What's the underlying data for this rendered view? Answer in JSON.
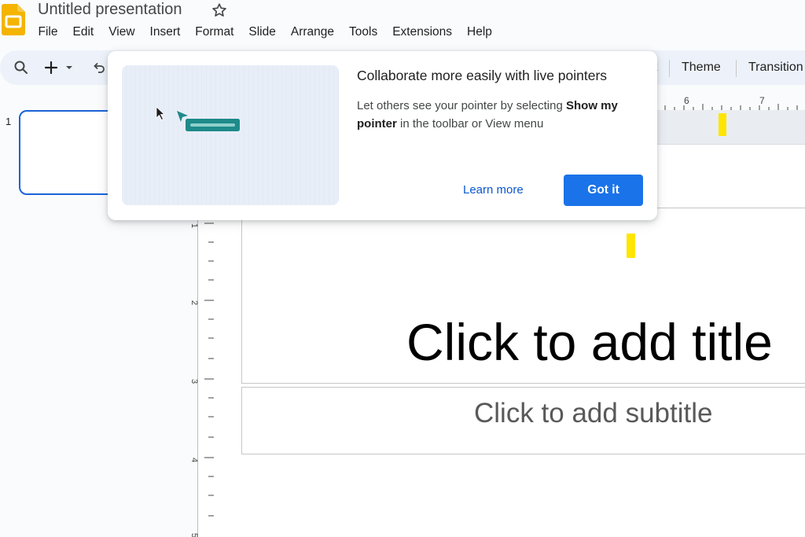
{
  "header": {
    "title": "Untitled presentation",
    "menu": [
      "File",
      "Edit",
      "View",
      "Insert",
      "Format",
      "Slide",
      "Arrange",
      "Tools",
      "Extensions",
      "Help"
    ]
  },
  "toolbar": {
    "theme_label": "Theme",
    "transition_label": "Transition",
    "partial_label": "t"
  },
  "ruler": {
    "h_labels": [
      "6",
      "7"
    ],
    "v_labels": [
      "1",
      "2",
      "3",
      "4",
      "5"
    ]
  },
  "filmstrip": {
    "slide_number": "1"
  },
  "slide": {
    "title_placeholder": "Click to add title",
    "subtitle_placeholder": "Click to add subtitle"
  },
  "popup": {
    "title": "Collaborate more easily with live pointers",
    "body_prefix": "Let others see your pointer by selecting ",
    "body_bold": "Show my pointer",
    "body_suffix": " in the toolbar or View menu",
    "learn_more": "Learn more",
    "got_it": "Got it"
  },
  "colors": {
    "accent": "#1a73e8",
    "link": "#0b57d0",
    "selection": "#1a63d8",
    "highlight": "#ffe500",
    "teal": "#1e8a8a",
    "logo": "#f4b400"
  }
}
